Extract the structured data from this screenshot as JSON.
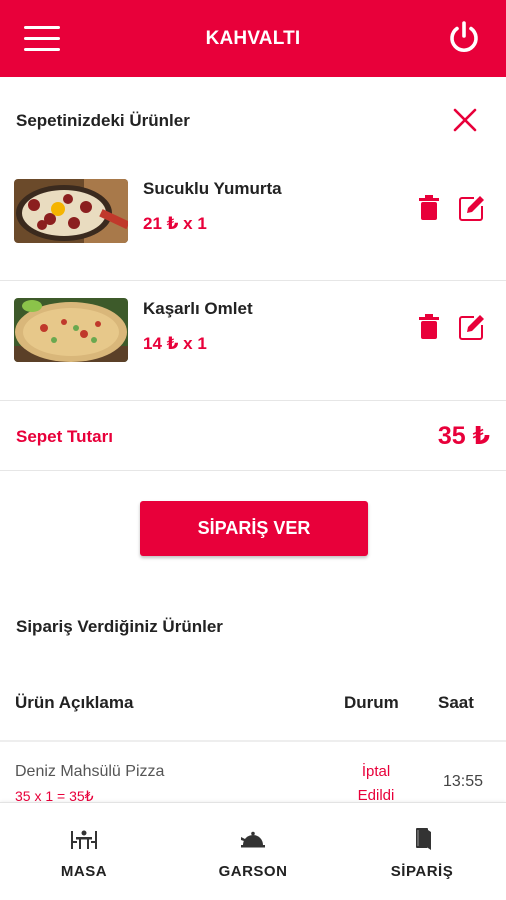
{
  "header": {
    "title": "KAHVALTI",
    "menu_icon": "hamburger-menu-icon",
    "power_icon": "power-icon",
    "color": "#e8003a"
  },
  "cart": {
    "heading": "Sepetinizdeki Ürünler",
    "close_icon": "close-icon",
    "items": [
      {
        "name": "Sucuklu Yumurta",
        "price": "21 ₺ x 1",
        "image": "sucuklu-yumurta-photo"
      },
      {
        "name": "Kaşarlı Omlet",
        "price": "14 ₺ x 1",
        "image": "kasarli-omlet-photo"
      }
    ],
    "total_label": "Sepet Tutarı",
    "total_value": "35 ₺"
  },
  "order_button": {
    "label": "SİPARİŞ VER"
  },
  "orders": {
    "heading": "Sipariş Verdiğiniz Ürünler",
    "columns": [
      "Ürün Açıklama",
      "Durum",
      "Saat"
    ],
    "rows": [
      {
        "name": "Deniz Mahsülü Pizza",
        "detail": "35 x 1 = 35₺",
        "status_line1": "İptal",
        "status_line2": "Edildi",
        "time": "13:55"
      }
    ]
  },
  "bottom_nav": {
    "items": [
      {
        "label": "MASA",
        "icon": "table-icon"
      },
      {
        "label": "GARSON",
        "icon": "waiter-bell-icon"
      },
      {
        "label": "SİPARİŞ",
        "icon": "menu-book-icon"
      }
    ]
  }
}
